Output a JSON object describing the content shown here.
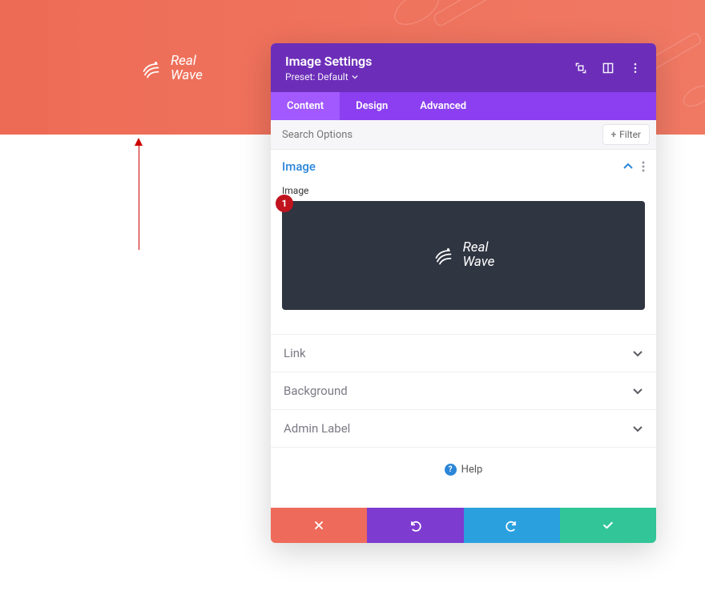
{
  "hero": {
    "brand_line1": "Real",
    "brand_line2": "Wave"
  },
  "modal": {
    "title": "Image Settings",
    "preset_label": "Preset: Default",
    "tabs": {
      "content": "Content",
      "design": "Design",
      "advanced": "Advanced",
      "active": "content"
    },
    "search_placeholder": "Search Options",
    "filter_label": "Filter",
    "section": {
      "title": "Image",
      "field_label": "Image",
      "badge": "1",
      "preview_brand_line1": "Real",
      "preview_brand_line2": "Wave"
    },
    "accordion": {
      "link": "Link",
      "background": "Background",
      "admin_label": "Admin Label"
    },
    "help_label": "Help",
    "colors": {
      "header": "#6c2eb9",
      "tabs_bg": "#8b3ff0",
      "tab_active": "#a259ff",
      "accent_blue": "#2b86d9",
      "badge_red": "#c1131e"
    }
  }
}
